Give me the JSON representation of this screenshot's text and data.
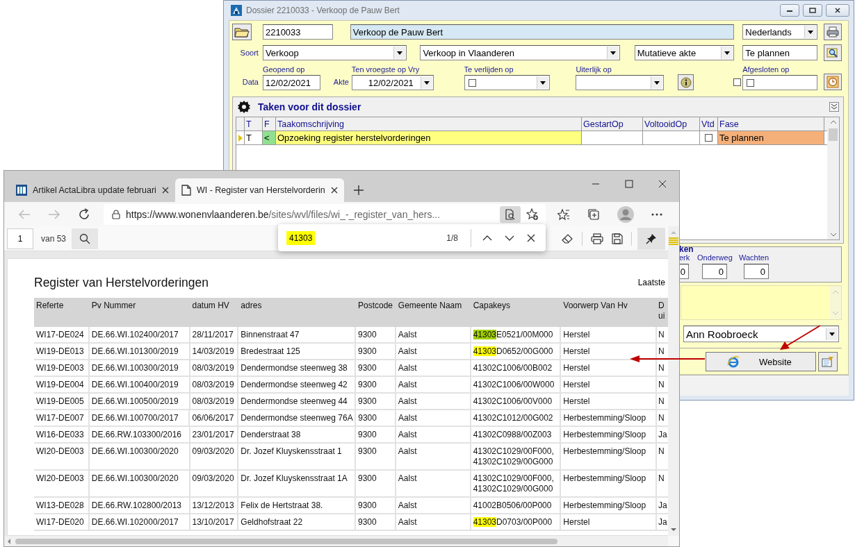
{
  "dossier": {
    "title": "Dossier 2210033 - Verkoop de Pauw Bert",
    "number": "2210033",
    "name": "Verkoop de Pauw Bert",
    "language": "Nederlands",
    "soort_label": "Soort",
    "soort": "Verkoop",
    "region": "Verkoop in Vlaanderen",
    "akte_type": "Mutatieve akte",
    "status": "Te plannen",
    "data_label": "Data",
    "akte_label": "Akte",
    "dates": [
      {
        "label": "Geopend op",
        "kind": "text",
        "value": "12/02/2021"
      },
      {
        "label": "Ten vroegste op Vry",
        "kind": "dropdown",
        "value": "12/02/2021"
      },
      {
        "label": "Te verlijden op",
        "kind": "check-dropdown",
        "checked": false
      },
      {
        "label": "Uiterlijk op",
        "kind": "dropdown"
      },
      {
        "label": "Afgesloten op",
        "kind": "check-text",
        "checked": false
      }
    ],
    "closed_check": {
      "checked": false
    },
    "tasks": {
      "title": "Taken voor dit dossier",
      "columns": [
        "T",
        "F",
        "Taakomschrijving",
        "GestartOp",
        "VoltooidOp",
        "Vtd",
        "Fase"
      ],
      "rows": [
        {
          "t": "T",
          "f": "<",
          "description": "Opzoeking register herstelvorderingen",
          "vtd": false,
          "fase": "Te plannen",
          "selected": true
        }
      ]
    },
    "stats": {
      "title": "ken",
      "counters": [
        {
          "label": "erk",
          "value": "0"
        },
        {
          "label": "Onderweg",
          "value": "0"
        },
        {
          "label": "Wachten",
          "value": "0"
        }
      ]
    },
    "person": "Ann Roobroeck",
    "website_button": "Website"
  },
  "browser": {
    "tabs": [
      {
        "title": "Artikel ActaLibra update februari",
        "selected": false
      },
      {
        "title": "WI - Register van Herstelvorderin",
        "selected": true
      }
    ],
    "url_host": "https://www.wonenvlaanderen.be",
    "url_path": "/sites/wvl/files/wi_-_register_van_hers...",
    "pdf": {
      "page": "1",
      "page_count": "van 53"
    },
    "find": {
      "query": "41303",
      "count": "1/8"
    },
    "document": {
      "title": "Register van Herstelvorderingen",
      "corner": "Laatste",
      "columns": [
        "Referte",
        "Pv Nummer",
        "datum HV",
        "adres",
        "Postcode",
        "Gemeente Naam",
        "Capakeys",
        "Voorwerp Van Hv",
        "D ui"
      ],
      "rows": [
        {
          "ref": "WI17-DE024",
          "pv": "DE.66.WI.102400/2017",
          "date": "28/11/2017",
          "address": "Binnenstraat 47",
          "postcode": "9300",
          "town": "Aalst",
          "capakeys": [
            {
              "text": "41303",
              "highlight": true,
              "current": true
            },
            {
              "text": "E0521/00M000",
              "highlight": false
            }
          ],
          "subject": "Herstel",
          "column_9": "N"
        },
        {
          "ref": "WI19-DE013",
          "pv": "DE.66.WI.101300/2019",
          "date": "14/03/2019",
          "address": "Bredestraat 125",
          "postcode": "9300",
          "town": "Aalst",
          "capakeys": [
            {
              "text": "41303",
              "highlight": true,
              "current": false
            },
            {
              "text": "D0652/00G000",
              "highlight": false
            }
          ],
          "subject": "Herstel",
          "column_9": "N"
        },
        {
          "ref": "WI19-DE003",
          "pv": "DE.66.WI.100300/2019",
          "date": "08/03/2019",
          "address": "Dendermondse steenweg 38",
          "postcode": "9300",
          "town": "Aalst",
          "capakeys": [
            {
              "text": "41302C1006/00B002",
              "highlight": false
            }
          ],
          "subject": "Herstel",
          "column_9": "N"
        },
        {
          "ref": "WI19-DE004",
          "pv": "DE.66.WI.100400/2019",
          "date": "08/03/2019",
          "address": "Dendermondse steenweg 42",
          "postcode": "9300",
          "town": "Aalst",
          "capakeys": [
            {
              "text": "41302C1006/00W000",
              "highlight": false
            }
          ],
          "subject": "Herstel",
          "column_9": "N"
        },
        {
          "ref": "WI19-DE005",
          "pv": "DE.66.WI.100500/2019",
          "date": "08/03/2019",
          "address": "Dendermondse steenweg 44",
          "postcode": "9300",
          "town": "Aalst",
          "capakeys": [
            {
              "text": "41302C1006/00V000",
              "highlight": false
            }
          ],
          "subject": "Herstel",
          "column_9": "N"
        },
        {
          "ref": "WI17-DE007",
          "pv": "DE.66.WI.100700/2017",
          "date": "06/06/2017",
          "address": "Dendermondse steenweg 76A",
          "postcode": "9300",
          "town": "Aalst",
          "capakeys": [
            {
              "text": "41302C1012/00G002",
              "highlight": false
            }
          ],
          "subject": "Herbestemming/Sloop",
          "column_9": "N"
        },
        {
          "ref": "WI16-DE033",
          "pv": "DE.66.RW.103300/2016",
          "date": "23/01/2017",
          "address": "Denderstraat 38",
          "postcode": "9300",
          "town": "Aalst",
          "capakeys": [
            {
              "text": "41302C0988/00Z003",
              "highlight": false
            }
          ],
          "subject": "Herbestemming/Sloop",
          "column_9": "Ja"
        },
        {
          "ref": "WI20-DE003",
          "pv": "DE.66.WI.100300/2020",
          "date": "09/03/2020",
          "address": "Dr. Jozef Kluyskensstraat 1",
          "postcode": "9300",
          "town": "Aalst",
          "capakeys": [
            {
              "text": "41302C1029/00F000,\n41302C1029/00G000",
              "highlight": false
            }
          ],
          "subject": "Herbestemming/Sloop",
          "column_9": "N"
        },
        {
          "ref": "WI20-DE003",
          "pv": "DE.66.WI.100300/2020",
          "date": "09/03/2020",
          "address": "Dr. Jozef Kluyskensstraat 1A",
          "postcode": "9300",
          "town": "Aalst",
          "capakeys": [
            {
              "text": "41302C1029/00F000,\n41302C1029/00G000",
              "highlight": false
            }
          ],
          "subject": "Herbestemming/Sloop",
          "column_9": "N"
        },
        {
          "ref": "WI13-DE028",
          "pv": "DE.66.RW.102800/2013",
          "date": "13/12/2013",
          "address": "Felix de Hertstraat 38.",
          "postcode": "9300",
          "town": "Aalst",
          "capakeys": [
            {
              "text": "41002B0506/00P000",
              "highlight": false
            }
          ],
          "subject": "Herbestemming/Sloop",
          "column_9": "Ja"
        },
        {
          "ref": "WI17-DE020",
          "pv": "DE.66.WI.102000/2017",
          "date": "13/10/2017",
          "address": "Geldhofstraat 22",
          "postcode": "9300",
          "town": "Aalst",
          "capakeys": [
            {
              "text": "41303",
              "highlight": true,
              "current": false
            },
            {
              "text": "D0703/00P000",
              "highlight": false
            }
          ],
          "subject": "Herstel",
          "column_9": "Ja"
        }
      ]
    }
  }
}
